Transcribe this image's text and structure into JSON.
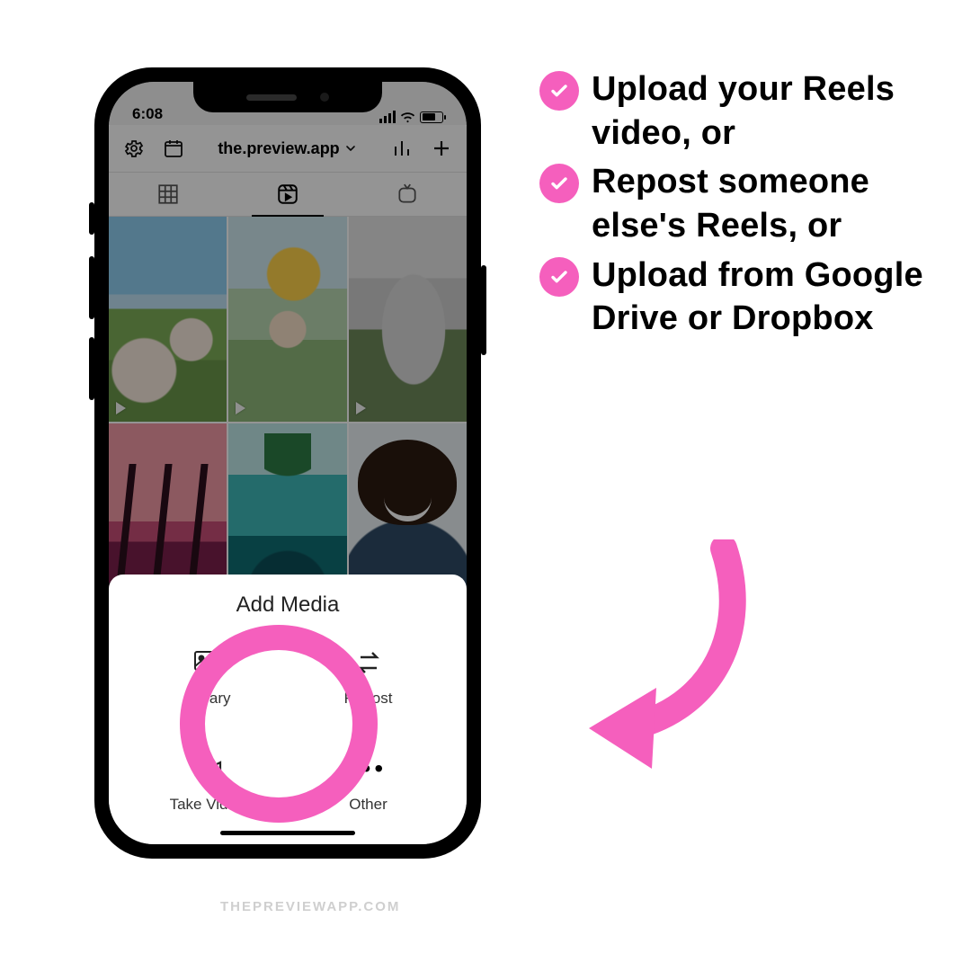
{
  "colors": {
    "accent": "#f55fbd"
  },
  "checklist": {
    "items": [
      {
        "text": "Upload your Reels video, or"
      },
      {
        "text": "Repost someone else's Reels, or"
      },
      {
        "text": "Upload from Google Drive or Dropbox"
      }
    ]
  },
  "watermark": "THEPREVIEWAPP.COM",
  "status": {
    "time": "6:08"
  },
  "header": {
    "account": "the.preview.app",
    "icons": {
      "settings": "gear-icon",
      "calendar": "calendar-icon",
      "analytics": "chart-icon",
      "add": "plus-icon",
      "dropdown": "chevron-down-icon"
    }
  },
  "tabs": {
    "grid": "grid-icon",
    "reels": "reels-icon",
    "igtv": "igtv-icon",
    "active": "reels"
  },
  "sheet": {
    "title": "Add Media",
    "items": [
      {
        "key": "library",
        "label": "Library"
      },
      {
        "key": "repost",
        "label": "Repost"
      },
      {
        "key": "take_video",
        "label": "Take Video"
      },
      {
        "key": "other",
        "label": "Other"
      }
    ]
  },
  "highlight": "library"
}
